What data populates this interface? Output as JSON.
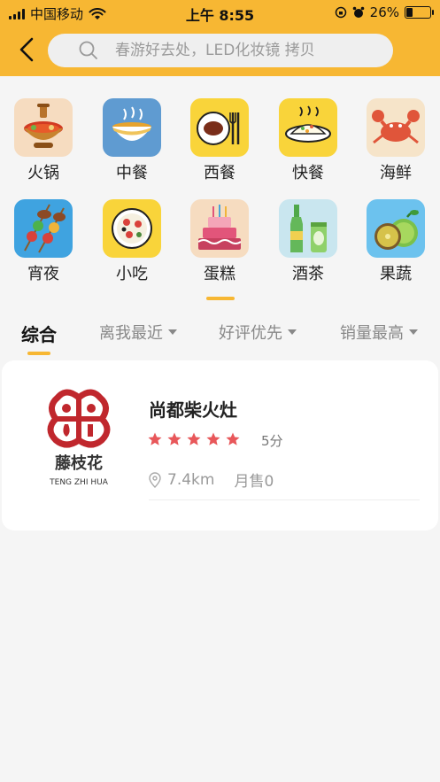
{
  "status_bar": {
    "carrier": "中国移动",
    "time": "上午 8:55",
    "battery_percent": "26%",
    "battery_level": 0.26
  },
  "search": {
    "placeholder": "春游好去处，LED化妆镜 拷贝"
  },
  "categories": [
    {
      "label": "火锅",
      "icon": "hotpot-icon"
    },
    {
      "label": "中餐",
      "icon": "soup-bowl-icon"
    },
    {
      "label": "西餐",
      "icon": "steak-icon"
    },
    {
      "label": "快餐",
      "icon": "rice-plate-icon"
    },
    {
      "label": "海鲜",
      "icon": "crab-icon"
    },
    {
      "label": "宵夜",
      "icon": "skewer-icon"
    },
    {
      "label": "小吃",
      "icon": "pizza-icon"
    },
    {
      "label": "蛋糕",
      "icon": "cake-icon"
    },
    {
      "label": "酒茶",
      "icon": "bottles-icon"
    },
    {
      "label": "果蔬",
      "icon": "fruit-icon"
    }
  ],
  "sort_tabs": [
    {
      "label": "综合",
      "active": true
    },
    {
      "label": "离我最近"
    },
    {
      "label": "好评优先"
    },
    {
      "label": "销量最高"
    }
  ],
  "shop": {
    "name": "尚都柴火灶",
    "rating": 5,
    "score_text": "5分",
    "distance": "7.4km",
    "sales": "月售0",
    "logo_text_cn": "藤枝花",
    "logo_text_en": "TENG ZHI HUA"
  },
  "colors": {
    "accent": "#f7b733",
    "star": "#e8575a",
    "logo_red": "#c0272d"
  }
}
